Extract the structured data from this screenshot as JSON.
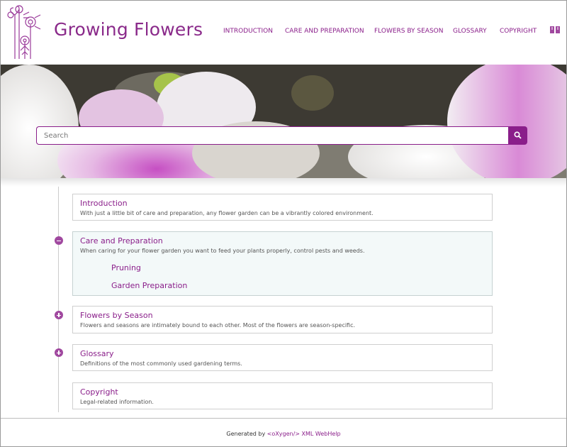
{
  "header": {
    "site_title": "Growing Flowers",
    "nav": [
      {
        "label": "INTRODUCTION"
      },
      {
        "label": "CARE AND PREPARATION"
      },
      {
        "label": "FLOWERS BY SEASON"
      },
      {
        "label": "GLOSSARY"
      },
      {
        "label": "COPYRIGHT"
      }
    ],
    "icons": {
      "logo": "flower-logo-icon",
      "index": "book-icon"
    }
  },
  "search": {
    "placeholder": "Search",
    "value": "",
    "button_icon": "search-icon"
  },
  "topics": [
    {
      "title": "Introduction",
      "description": "With just a little bit of care and preparation, any flower garden can be a vibrantly colored environment.",
      "toggle": "none"
    },
    {
      "title": "Care and Preparation",
      "description": "When caring for your flower garden you want to feed your plants properly, control pests and weeds.",
      "toggle": "collapse",
      "expanded": true,
      "children": [
        {
          "label": "Pruning"
        },
        {
          "label": "Garden Preparation"
        }
      ]
    },
    {
      "title": "Flowers by Season",
      "description": "Flowers and seasons are intimately bound to each other. Most of the flowers are season-specific.",
      "toggle": "expand"
    },
    {
      "title": "Glossary",
      "description": "Definitions of the most commonly used gardening terms.",
      "toggle": "expand"
    },
    {
      "title": "Copyright",
      "description": "Legal-related information.",
      "toggle": "none"
    }
  ],
  "footer": {
    "prefix": "Generated by ",
    "link": "<oXygen/> XML WebHelp"
  },
  "colors": {
    "accent": "#8a1e8a",
    "toggle": "#a0489f",
    "expanded_bg": "#f3f9f9"
  }
}
